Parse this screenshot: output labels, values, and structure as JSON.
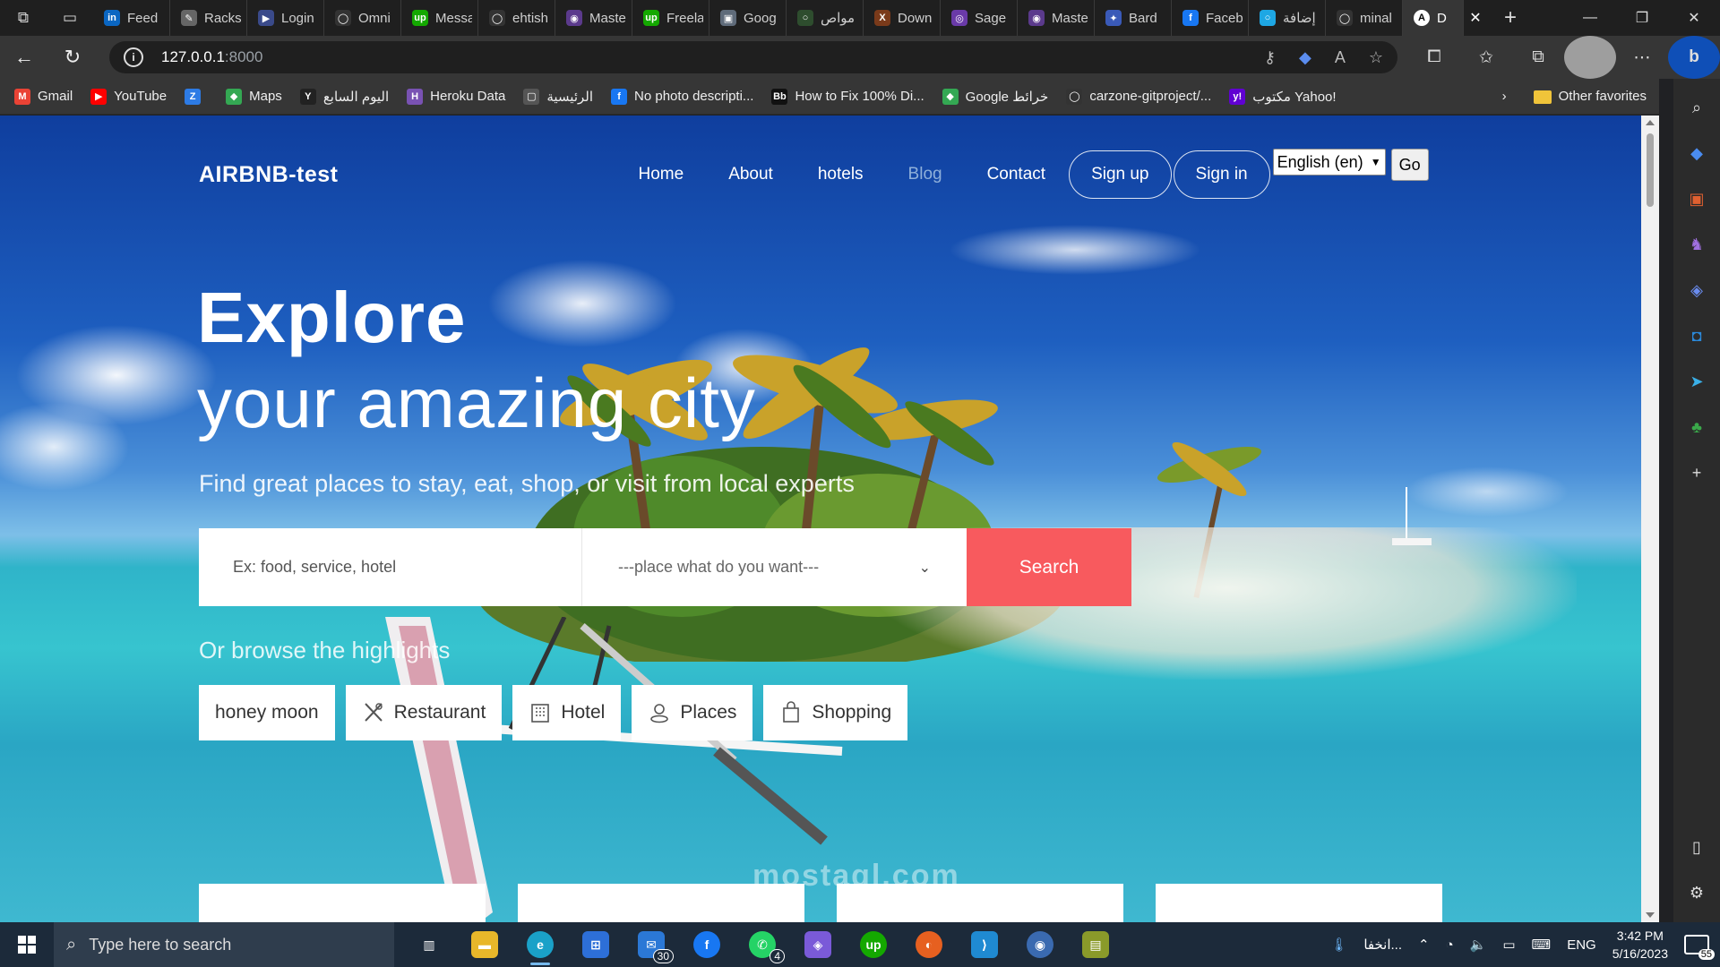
{
  "browser": {
    "tabs": [
      {
        "label": "Feed",
        "icon": "linkedin-icon",
        "color": "#0a66c2",
        "glyph": "in"
      },
      {
        "label": "Racks",
        "icon": "pen-icon",
        "color": "#666666",
        "glyph": "✎"
      },
      {
        "label": "Login",
        "icon": "arrow-icon",
        "color": "#3a4a8a",
        "glyph": "▶"
      },
      {
        "label": "Omni",
        "icon": "github-icon",
        "color": "#333333",
        "glyph": "◯"
      },
      {
        "label": "Messa",
        "icon": "upwork-icon",
        "color": "#14a800",
        "glyph": "up"
      },
      {
        "label": "ehtish",
        "icon": "github-icon",
        "color": "#333333",
        "glyph": "◯"
      },
      {
        "label": "Maste",
        "icon": "course-icon",
        "color": "#5b3a8c",
        "glyph": "◉"
      },
      {
        "label": "Freela",
        "icon": "upwork-icon",
        "color": "#14a800",
        "glyph": "up"
      },
      {
        "label": "Goog",
        "icon": "image-icon",
        "color": "#5f6b7a",
        "glyph": "▣"
      },
      {
        "label": "مواص",
        "icon": "circle-icon",
        "color": "#2e4d2e",
        "glyph": "○"
      },
      {
        "label": "Down",
        "icon": "x-icon",
        "color": "#7a3a1a",
        "glyph": "X"
      },
      {
        "label": "Sage",
        "icon": "chat-icon",
        "color": "#6a3aa8",
        "glyph": "◎"
      },
      {
        "label": "Maste",
        "icon": "course-icon",
        "color": "#5b3a8c",
        "glyph": "◉"
      },
      {
        "label": "Bard",
        "icon": "sparkle-icon",
        "color": "#3a5ab8",
        "glyph": "✦"
      },
      {
        "label": "Faceb",
        "icon": "facebook-icon",
        "color": "#1877f2",
        "glyph": "f"
      },
      {
        "label": "إضافة",
        "icon": "ring-icon",
        "color": "#1ea7e4",
        "glyph": "○"
      },
      {
        "label": "minal",
        "icon": "github-icon",
        "color": "#333333",
        "glyph": "◯"
      }
    ],
    "active_tab": {
      "label": "D",
      "glyph": "A"
    },
    "url_host": "127.0.0.1",
    "url_port": ":8000"
  },
  "bookmarks": [
    {
      "label": "Gmail",
      "color": "#ea4335",
      "glyph": "M"
    },
    {
      "label": "YouTube",
      "color": "#ff0000",
      "glyph": "▶"
    },
    {
      "label": "",
      "color": "#2d7be5",
      "glyph": "Z"
    },
    {
      "label": "Maps",
      "color": "#34a853",
      "glyph": "◆"
    },
    {
      "label": "اليوم السابع",
      "color": "#222222",
      "glyph": "Y"
    },
    {
      "label": "Heroku Data",
      "color": "#7952b3",
      "glyph": "H"
    },
    {
      "label": "الرئيسية",
      "color": "#555555",
      "glyph": "▢"
    },
    {
      "label": "No photo descripti...",
      "color": "#1877f2",
      "glyph": "f"
    },
    {
      "label": "How to Fix 100% Di...",
      "color": "#111111",
      "glyph": "Bb"
    },
    {
      "label": "Google خرائط",
      "color": "#34a853",
      "glyph": "◆"
    },
    {
      "label": "carzone-gitproject/...",
      "color": "#333333",
      "glyph": "◯"
    },
    {
      "label": "مكتوب Yahoo!",
      "color": "#6001d2",
      "glyph": "y!"
    }
  ],
  "bookmarks_other": "Other favorites",
  "site": {
    "brand": "AIRBNB-test",
    "nav": {
      "home": "Home",
      "about": "About",
      "hotels": "hotels",
      "blog": "Blog",
      "contact": "Contact",
      "signup": "Sign up",
      "signin": "Sign in",
      "language": "English (en)",
      "go": "Go"
    },
    "hero": {
      "title_bold": "Explore",
      "title_light": "your amazing city",
      "subtitle": "Find great places to stay, eat, shop, or visit from local experts"
    },
    "search": {
      "placeholder": "Ex: food, service, hotel",
      "select_value": "---place what do you want---",
      "button": "Search"
    },
    "browse_label": "Or browse the highlights",
    "highlights": [
      {
        "label": "honey moon",
        "icon": ""
      },
      {
        "label": "Restaurant",
        "icon": "utensils-icon"
      },
      {
        "label": "Hotel",
        "icon": "building-icon"
      },
      {
        "label": "Places",
        "icon": "map-pin-icon"
      },
      {
        "label": "Shopping",
        "icon": "shopping-bag-icon"
      }
    ]
  },
  "watermark": "mostaql.com",
  "taskbar": {
    "search_placeholder": "Type here to search",
    "mail_badge": "30",
    "whatsapp_badge": "4",
    "weather_text": "انخفا...",
    "lang": "ENG",
    "time": "3:42 PM",
    "date": "5/16/2023",
    "notifications": "55"
  }
}
